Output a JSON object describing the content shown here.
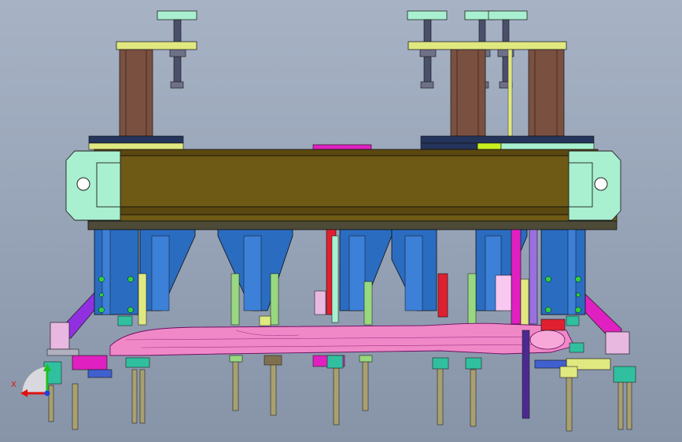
{
  "view": {
    "background_top": "#a7b3c5",
    "background_bottom": "#8794a8"
  },
  "triad": {
    "x_axis_label": "X",
    "x_color": "#e01010",
    "y_color": "#20c020",
    "z_color": "#2040e0"
  },
  "palette": {
    "beam": "#6e5a14",
    "column": "#7a5040",
    "end_plate": "#a8f0d0",
    "clamp_bracket": "#2a6cc0",
    "workpiece": "#f088c8",
    "locator_pin": "#a8a070",
    "pad_yellow": "#e0e880",
    "pad_magenta": "#e020c0",
    "pad_navy": "#24345a",
    "side_arm": "#9030e0"
  }
}
